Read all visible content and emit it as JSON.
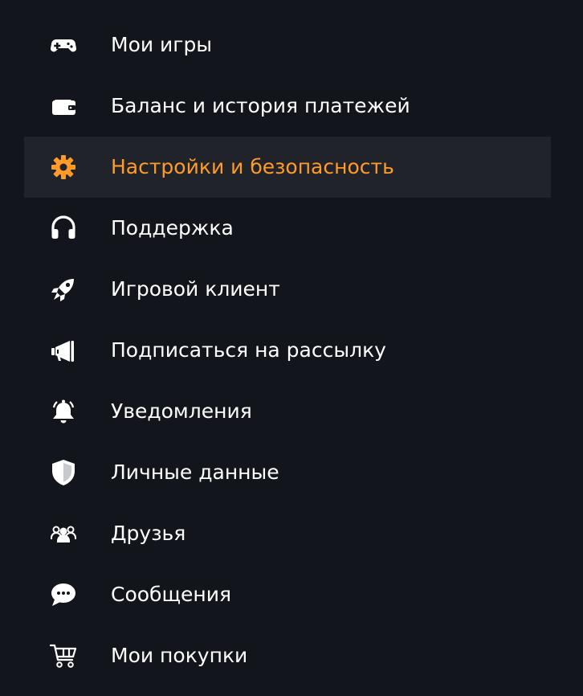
{
  "colors": {
    "background": "#13151d",
    "active_background": "#21232b",
    "text": "#ffffff",
    "accent": "#ff9b26"
  },
  "menu": {
    "items": [
      {
        "label": "Мои игры",
        "icon": "gamepad-icon",
        "active": false
      },
      {
        "label": "Баланс и история платежей",
        "icon": "wallet-icon",
        "active": false
      },
      {
        "label": "Настройки и безопасность",
        "icon": "gear-icon",
        "active": true
      },
      {
        "label": "Поддержка",
        "icon": "headset-icon",
        "active": false
      },
      {
        "label": "Игровой клиент",
        "icon": "rocket-icon",
        "active": false
      },
      {
        "label": "Подписаться на рассылку",
        "icon": "megaphone-icon",
        "active": false
      },
      {
        "label": "Уведомления",
        "icon": "bell-icon",
        "active": false
      },
      {
        "label": "Личные данные",
        "icon": "shield-icon",
        "active": false
      },
      {
        "label": "Друзья",
        "icon": "friends-icon",
        "active": false
      },
      {
        "label": "Сообщения",
        "icon": "chat-icon",
        "active": false
      },
      {
        "label": "Мои покупки",
        "icon": "cart-icon",
        "active": false
      }
    ]
  }
}
